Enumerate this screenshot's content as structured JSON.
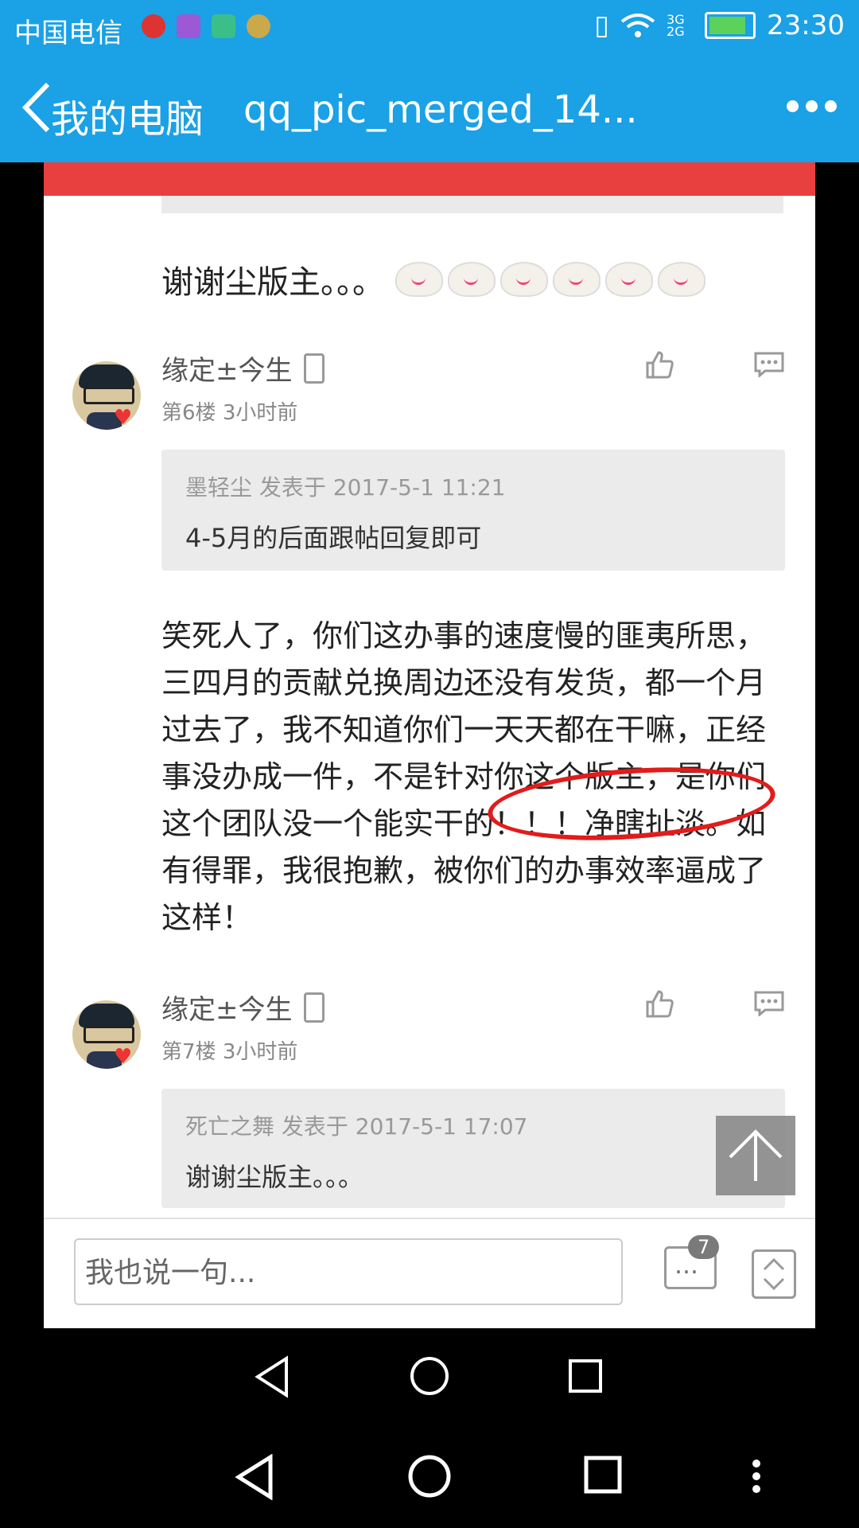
{
  "statusbar": {
    "carrier": "中国电信",
    "network": "3G 2G",
    "time": "23:30"
  },
  "appbar": {
    "back_label": "我的电脑",
    "title": "qq_pic_merged_14..."
  },
  "thread": {
    "top_reply_text": "谢谢尘版主。。。",
    "posts": [
      {
        "username": "缘定±今生",
        "floor": "第6楼",
        "time": "3小时前",
        "quote_header": "墨轻尘 发表于 2017-5-1 11:21",
        "quote_text": "4-5月的后面跟帖回复即可",
        "content": "笑死人了，你们这办事的速度慢的匪夷所思，三四月的贡献兑换周边还没有发货，都一个月过去了，我不知道你们一天天都在干嘛，正经事没办成一件，不是针对你这个版主，是你们这个团队没一个能实干的！！！净瞎扯淡。如有得罪，我很抱歉，被你们的办事效率逼成了这样！"
      },
      {
        "username": "缘定±今生",
        "floor": "第7楼",
        "time": "3小时前",
        "quote_header": "死亡之舞 发表于 2017-5-1 17:07",
        "quote_text": "谢谢尘版主。。。"
      }
    ]
  },
  "reply_bar": {
    "placeholder": "我也说一句...",
    "comment_count": "7"
  }
}
